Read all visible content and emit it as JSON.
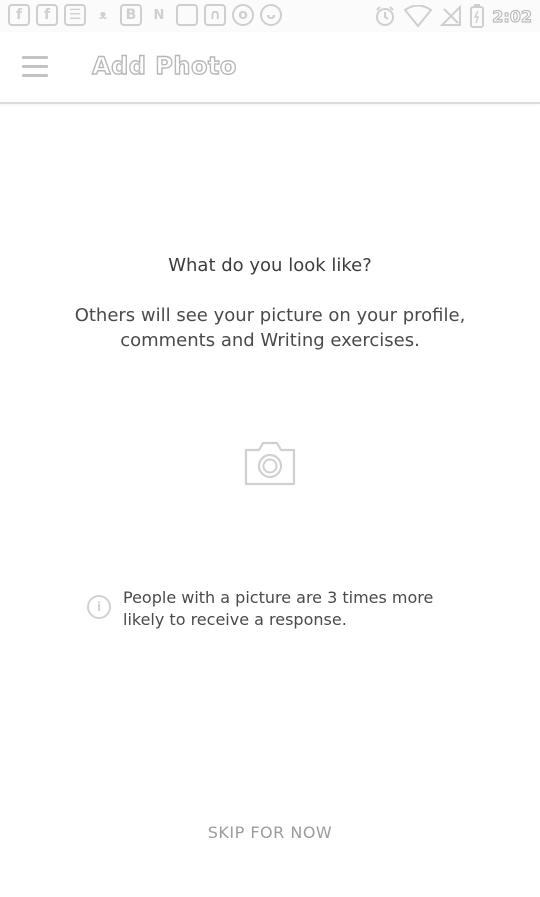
{
  "status_bar": {
    "time": "2:02",
    "left_icons": [
      {
        "name": "facebook-icon",
        "glyph": "f"
      },
      {
        "name": "facebook-icon",
        "glyph": "f"
      },
      {
        "name": "message-icon",
        "glyph": "☰"
      },
      {
        "name": "cat-icon",
        "glyph": "ᴥ"
      },
      {
        "name": "b-app-icon",
        "glyph": "B"
      },
      {
        "name": "n-app-icon",
        "glyph": "N"
      },
      {
        "name": "square-app-icon",
        "glyph": ""
      },
      {
        "name": "lock-app-icon",
        "glyph": "∩"
      },
      {
        "name": "circle-app-icon",
        "glyph": "o"
      },
      {
        "name": "ghost-app-icon",
        "glyph": "ᴗ"
      }
    ],
    "right_icons": [
      "alarm-icon",
      "wifi-icon",
      "no-signal-icon",
      "battery-charging-icon"
    ]
  },
  "app_bar": {
    "title": "Add Photo",
    "menu_icon": "hamburger-menu-icon"
  },
  "content": {
    "question": "What do you look like?",
    "description": "Others will see your picture on your profile, comments and Writing exercises.",
    "camera_icon": "camera-icon",
    "info_icon": "info-icon",
    "info_glyph": "i",
    "info_text": "People with a picture are 3 times more likely to receive a response.",
    "skip_label": "SKIP FOR NOW"
  },
  "colors": {
    "icon_gray": "#cfcfcf",
    "text_dark": "#3d3d3d",
    "skip_gray": "#9c9c9c",
    "divider": "#dcdcdc"
  }
}
